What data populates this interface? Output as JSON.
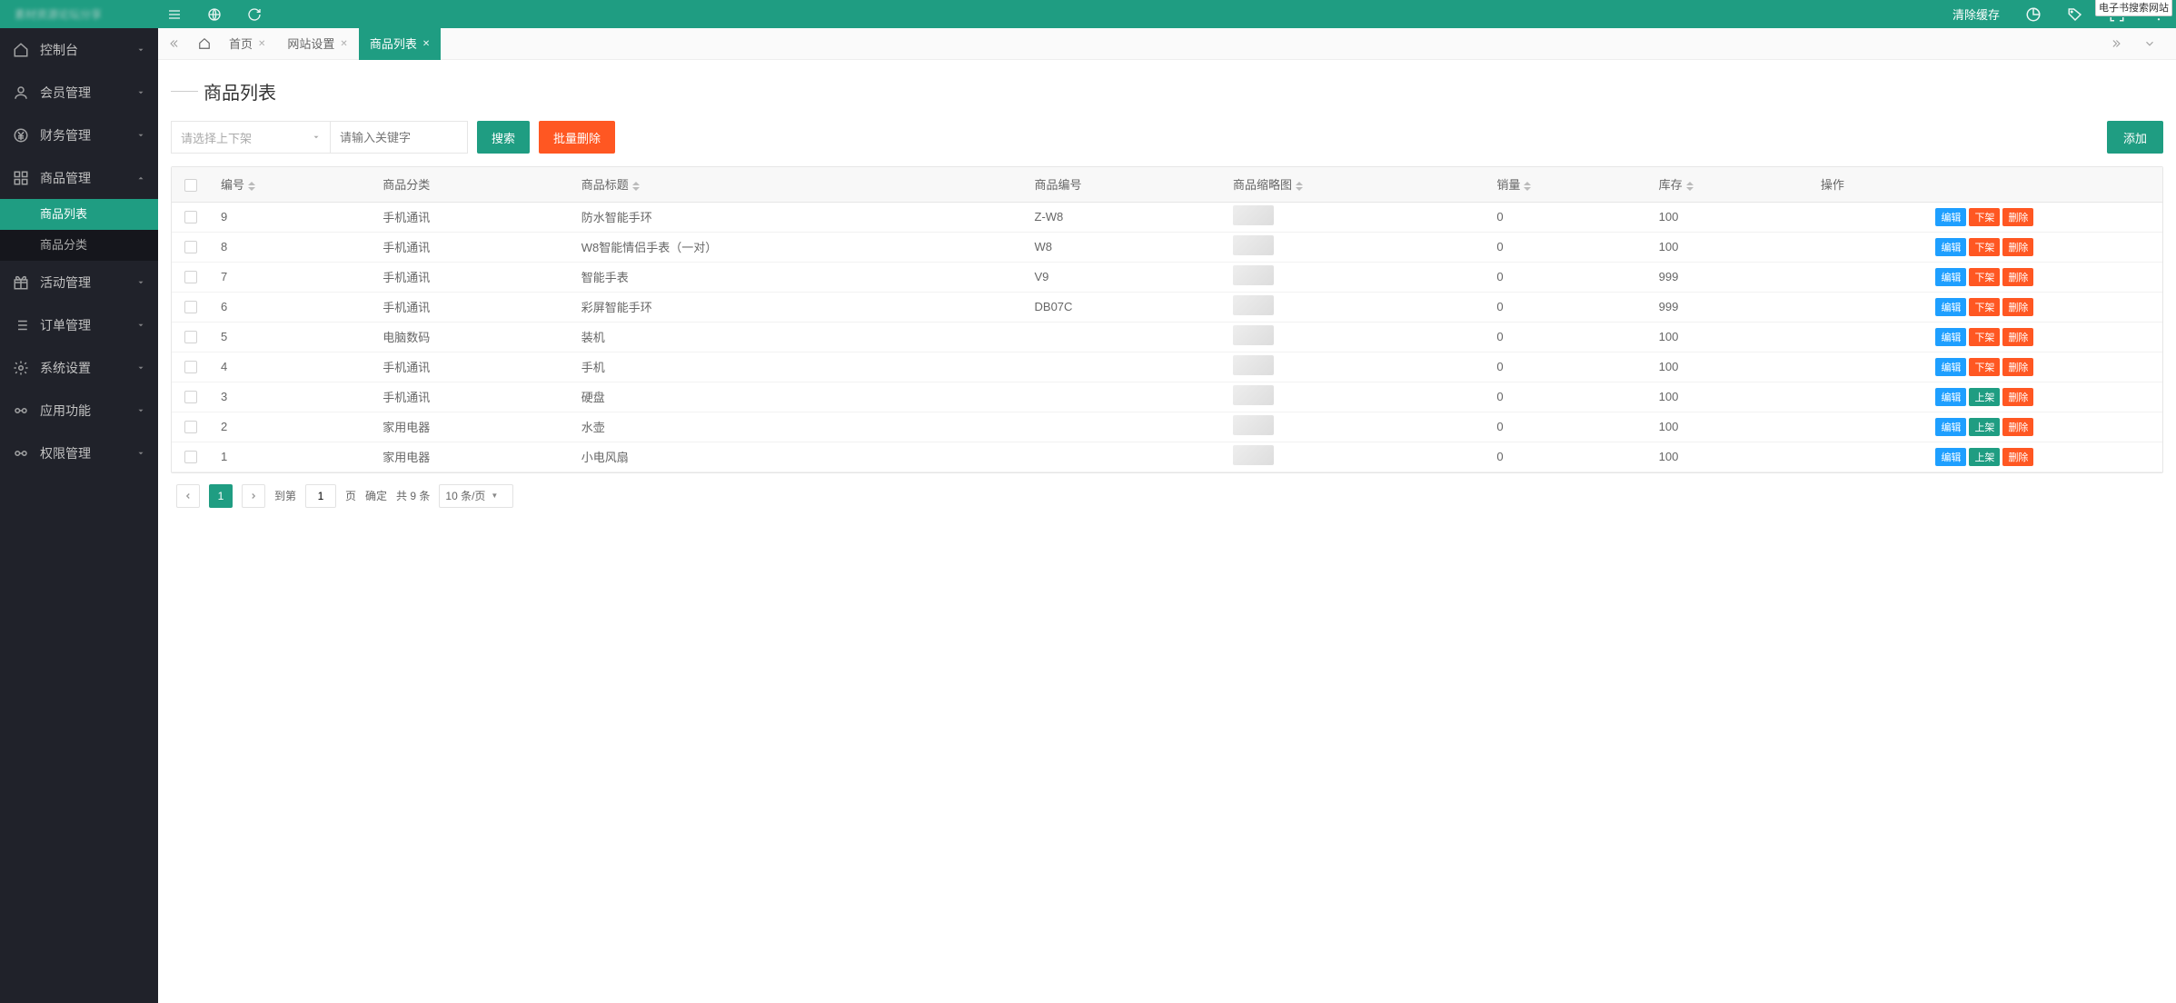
{
  "topbar": {
    "logo_text": "素材资源论坛分享",
    "clear_cache": "清除缓存",
    "float_label": "电子书搜索网站"
  },
  "sidebar": {
    "items": [
      {
        "icon": "home",
        "label": "控制台",
        "open": false,
        "subs": []
      },
      {
        "icon": "user",
        "label": "会员管理",
        "open": false,
        "subs": []
      },
      {
        "icon": "yen",
        "label": "财务管理",
        "open": false,
        "subs": []
      },
      {
        "icon": "grid",
        "label": "商品管理",
        "open": true,
        "subs": [
          {
            "label": "商品列表",
            "active": true
          },
          {
            "label": "商品分类",
            "active": false
          }
        ]
      },
      {
        "icon": "gift",
        "label": "活动管理",
        "open": false,
        "subs": []
      },
      {
        "icon": "list",
        "label": "订单管理",
        "open": false,
        "subs": []
      },
      {
        "icon": "gear",
        "label": "系统设置",
        "open": false,
        "subs": []
      },
      {
        "icon": "link",
        "label": "应用功能",
        "open": false,
        "subs": []
      },
      {
        "icon": "link",
        "label": "权限管理",
        "open": false,
        "subs": []
      }
    ]
  },
  "tabs": {
    "items": [
      {
        "label": "首页",
        "closable": true,
        "active": false
      },
      {
        "label": "网站设置",
        "closable": true,
        "active": false
      },
      {
        "label": "商品列表",
        "closable": true,
        "active": true
      }
    ]
  },
  "page": {
    "title": "商品列表"
  },
  "filters": {
    "select_placeholder": "请选择上下架",
    "input_placeholder": "请输入关键字",
    "search_btn": "搜索",
    "batch_del_btn": "批量删除",
    "add_btn": "添加"
  },
  "table": {
    "headers": [
      "",
      "编号",
      "商品分类",
      "商品标题",
      "商品编号",
      "商品缩略图",
      "销量",
      "库存",
      "操作"
    ],
    "sortable": [
      false,
      true,
      false,
      true,
      false,
      true,
      true,
      true,
      false
    ],
    "rows": [
      {
        "id": "9",
        "cat": "手机通讯",
        "title": "防水智能手环",
        "sku": "Z-W8",
        "sales": "0",
        "stock": "100",
        "shelf": "down"
      },
      {
        "id": "8",
        "cat": "手机通讯",
        "title": "W8智能情侣手表（一对）",
        "sku": "W8",
        "sales": "0",
        "stock": "100",
        "shelf": "down"
      },
      {
        "id": "7",
        "cat": "手机通讯",
        "title": "智能手表",
        "sku": "V9",
        "sales": "0",
        "stock": "999",
        "shelf": "down"
      },
      {
        "id": "6",
        "cat": "手机通讯",
        "title": "彩屏智能手环",
        "sku": "DB07C",
        "sales": "0",
        "stock": "999",
        "shelf": "down"
      },
      {
        "id": "5",
        "cat": "电脑数码",
        "title": "装机",
        "sku": "",
        "sales": "0",
        "stock": "100",
        "shelf": "down"
      },
      {
        "id": "4",
        "cat": "手机通讯",
        "title": "手机",
        "sku": "",
        "sales": "0",
        "stock": "100",
        "shelf": "down"
      },
      {
        "id": "3",
        "cat": "手机通讯",
        "title": "硬盘",
        "sku": "",
        "sales": "0",
        "stock": "100",
        "shelf": "up"
      },
      {
        "id": "2",
        "cat": "家用电器",
        "title": "水壶",
        "sku": "",
        "sales": "0",
        "stock": "100",
        "shelf": "up"
      },
      {
        "id": "1",
        "cat": "家用电器",
        "title": "小电风扇",
        "sku": "",
        "sales": "0",
        "stock": "100",
        "shelf": "up"
      }
    ],
    "actions": {
      "edit": "编辑",
      "down": "下架",
      "up": "上架",
      "del": "删除"
    }
  },
  "pager": {
    "current": "1",
    "goto_label": "到第",
    "page_label": "页",
    "confirm": "确定",
    "total": "共 9 条",
    "per_page": "10 条/页"
  }
}
